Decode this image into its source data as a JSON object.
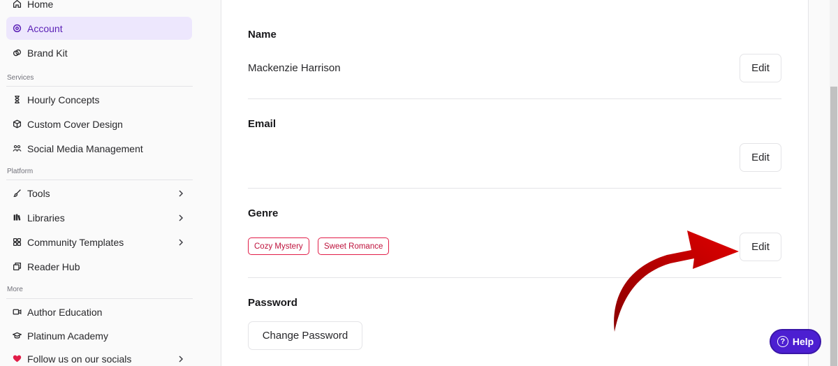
{
  "sidebar": {
    "items_top": [
      {
        "label": "Home",
        "icon": "home-icon"
      },
      {
        "label": "Account",
        "icon": "account-icon",
        "active": true
      },
      {
        "label": "Brand Kit",
        "icon": "brand-kit-icon"
      }
    ],
    "services_label": "Services",
    "services": [
      {
        "label": "Hourly Concepts",
        "icon": "hourglass-icon"
      },
      {
        "label": "Custom Cover Design",
        "icon": "box-icon"
      },
      {
        "label": "Social Media Management",
        "icon": "people-icon"
      }
    ],
    "platform_label": "Platform",
    "platform": [
      {
        "label": "Tools",
        "icon": "brush-icon"
      },
      {
        "label": "Libraries",
        "icon": "library-icon"
      },
      {
        "label": "Community Templates",
        "icon": "grid-icon"
      },
      {
        "label": "Reader Hub",
        "icon": "reader-hub-icon"
      }
    ],
    "more_label": "More",
    "more": [
      {
        "label": "Author Education",
        "icon": "video-icon"
      },
      {
        "label": "Platinum Academy",
        "icon": "graduation-cap-icon"
      },
      {
        "label": "Follow us on our socials",
        "icon": "heart-icon"
      }
    ]
  },
  "account": {
    "name_label": "Name",
    "name_value": "Mackenzie Harrison",
    "email_label": "Email",
    "email_value": "",
    "genre_label": "Genre",
    "genres": [
      "Cozy Mystery",
      "Sweet Romance"
    ],
    "password_label": "Password",
    "change_password_label": "Change Password",
    "edit_label": "Edit"
  },
  "help": {
    "label": "Help"
  },
  "colors": {
    "accent": "#5b21b6",
    "active_bg": "#ede7fd",
    "tag": "#e11d48",
    "help_bg": "#4c1fd1",
    "arrow": "#b00000"
  }
}
